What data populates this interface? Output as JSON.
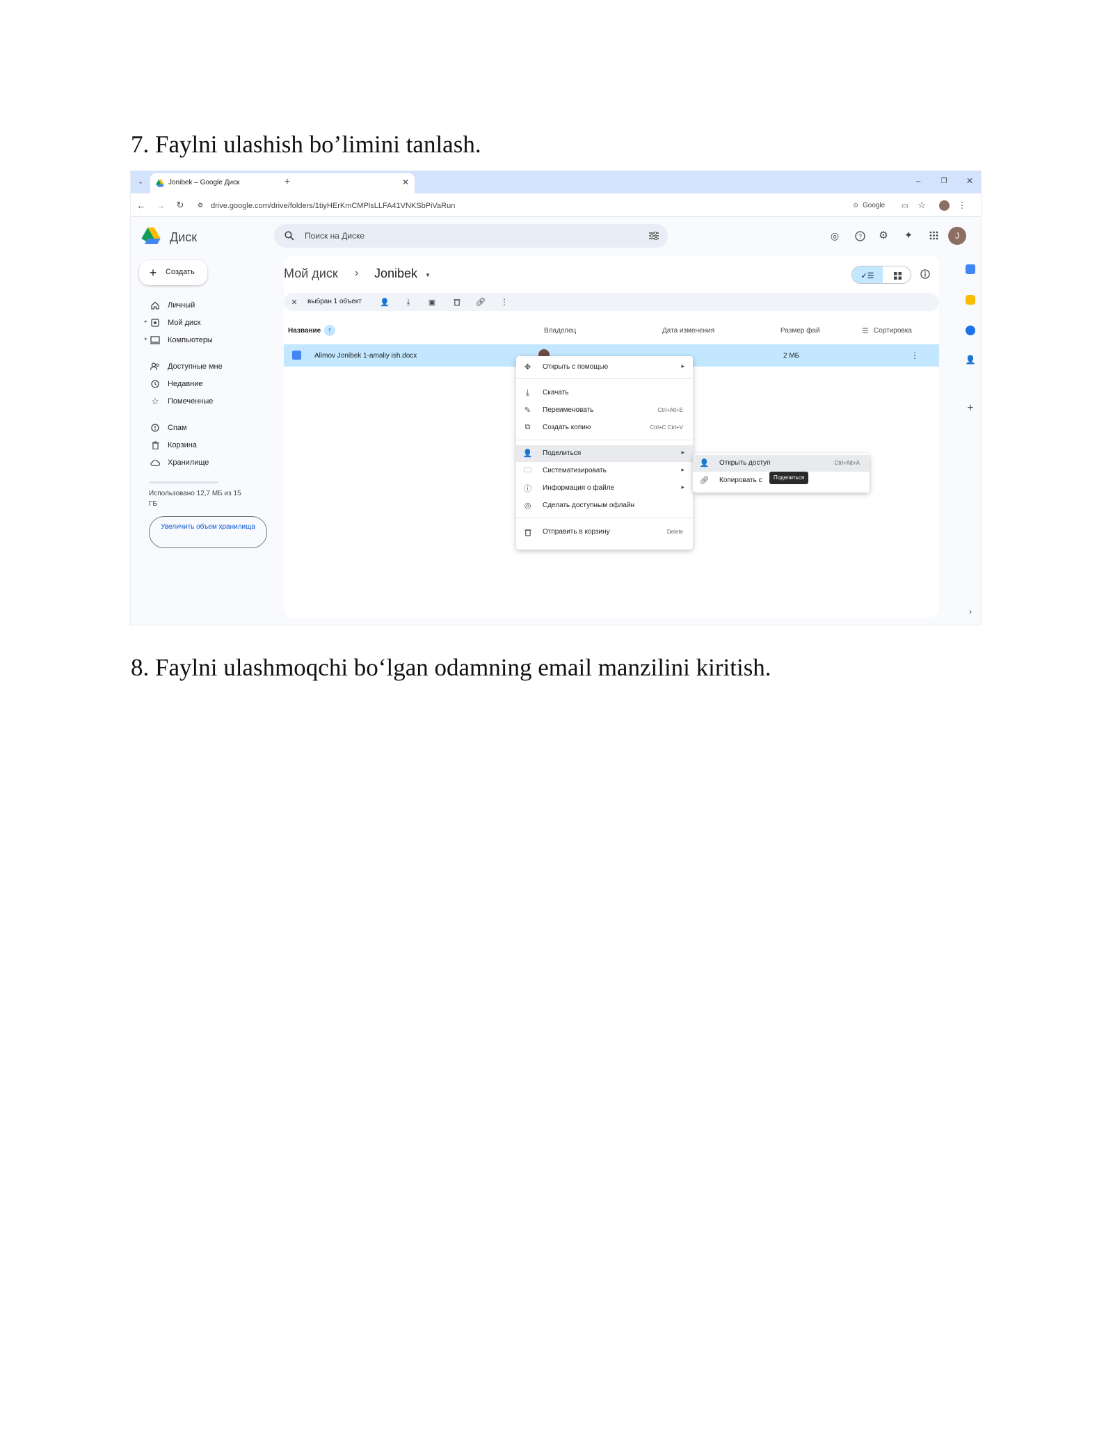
{
  "document": {
    "step7_heading": "7. Faylni ulashish bo’limini tanlash.",
    "step8_heading": "8. Faylni ulashmoqchi bo‘lgan odamning email manzilini kiritish."
  },
  "browser": {
    "tab_title": "Jonibek – Google Диск",
    "url": "drive.google.com/drive/folders/1tiyHErKmCMPlsLLFA41VNKSbPiVaRun",
    "google_chip": "Google"
  },
  "drive": {
    "brand": "Диск",
    "search_placeholder": "Поиск на Диске",
    "create_label": "Создать",
    "sidebar": [
      {
        "label": "Личный",
        "icon": "home-icon"
      },
      {
        "label": "Мой диск",
        "icon": "drive-icon"
      },
      {
        "label": "Компьютеры",
        "icon": "computer-icon"
      },
      {
        "label": "Доступные мне",
        "icon": "shared-icon"
      },
      {
        "label": "Недавние",
        "icon": "clock-icon"
      },
      {
        "label": "Помеченные",
        "icon": "star-icon"
      },
      {
        "label": "Спам",
        "icon": "spam-icon"
      },
      {
        "label": "Корзина",
        "icon": "trash-icon"
      },
      {
        "label": "Хранилище",
        "icon": "cloud-icon"
      }
    ],
    "storage_text": "Использовано 12,7 МБ из 15 ГБ",
    "upgrade_label": "Увеличить объем хранилища",
    "breadcrumb_root": "Мой диск",
    "breadcrumb_sep": "›",
    "breadcrumb_current": "Jonibek",
    "selection_text": "выбран 1 объект",
    "columns": {
      "name": "Название",
      "owner": "Владелец",
      "modified": "Дата изменения",
      "size": "Размер фай",
      "sort": "Сортировка"
    },
    "file": {
      "name": "Alimov Jonibek 1-amaliy ish.docx",
      "size": "2 МБ"
    },
    "context_menu": [
      {
        "label": "Открыть с помощью",
        "shortcut": "",
        "arrow": "▸",
        "icon": "move-icon"
      },
      {
        "label": "Скачать",
        "shortcut": "",
        "arrow": "",
        "icon": "download-icon"
      },
      {
        "label": "Переименовать",
        "shortcut": "Ctrl+Alt+E",
        "arrow": "",
        "icon": "pencil-icon"
      },
      {
        "label": "Создать копию",
        "shortcut": "Ctrl+C Ctrl+V",
        "arrow": "",
        "icon": "copy-icon"
      },
      {
        "label": "Поделиться",
        "shortcut": "",
        "arrow": "▸",
        "icon": "share-person-icon"
      },
      {
        "label": "Систематизировать",
        "shortcut": "",
        "arrow": "▸",
        "icon": "folder-icon"
      },
      {
        "label": "Информация о файле",
        "shortcut": "",
        "arrow": "▸",
        "icon": "info-icon"
      },
      {
        "label": "Сделать доступным офлайн",
        "shortcut": "",
        "arrow": "",
        "icon": "offline-icon"
      },
      {
        "label": "Отправить в корзину",
        "shortcut": "Delete",
        "arrow": "",
        "icon": "trash-icon"
      }
    ],
    "submenu": [
      {
        "label": "Открыть доступ",
        "shortcut": "Ctrl+Alt+A",
        "icon": "add-person-icon"
      },
      {
        "label": "Копировать с",
        "shortcut": "",
        "icon": "link-icon"
      }
    ],
    "tooltip": "Поделиться",
    "avatar_letter": "J"
  }
}
